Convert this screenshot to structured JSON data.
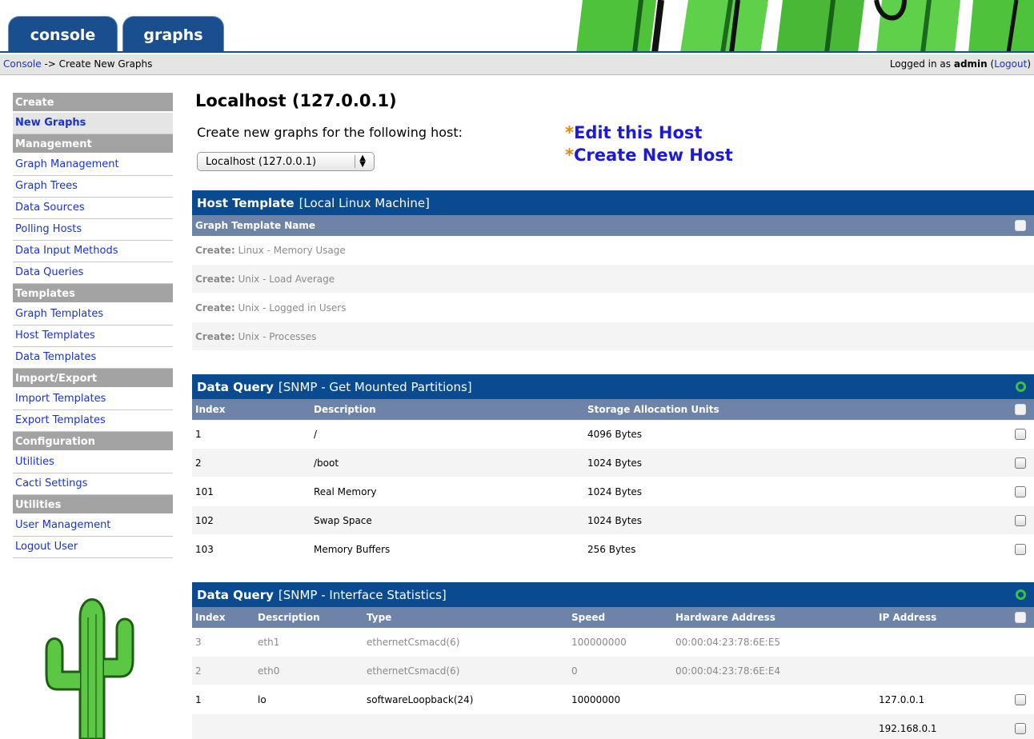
{
  "tabs": [
    {
      "label": "console"
    },
    {
      "label": "graphs"
    }
  ],
  "breadcrumb": {
    "link": "Console",
    "arrow": " -> ",
    "current": "Create New Graphs"
  },
  "login": {
    "prefix": "Logged in as ",
    "user": "admin",
    "open": " (",
    "logout": "Logout",
    "close": ")"
  },
  "sidebar": {
    "sections": [
      {
        "head": "Create",
        "items": [
          {
            "label": "New Graphs",
            "active": true
          }
        ]
      },
      {
        "head": "Management",
        "items": [
          {
            "label": "Graph Management"
          },
          {
            "label": "Graph Trees"
          },
          {
            "label": "Data Sources"
          },
          {
            "label": "Polling Hosts"
          },
          {
            "label": "Data Input Methods"
          },
          {
            "label": "Data Queries"
          }
        ]
      },
      {
        "head": "Templates",
        "items": [
          {
            "label": "Graph Templates"
          },
          {
            "label": "Host Templates"
          },
          {
            "label": "Data Templates"
          }
        ]
      },
      {
        "head": "Import/Export",
        "items": [
          {
            "label": "Import Templates"
          },
          {
            "label": "Export Templates"
          }
        ]
      },
      {
        "head": "Configuration",
        "items": [
          {
            "label": "Utilities"
          },
          {
            "label": "Cacti Settings"
          }
        ]
      },
      {
        "head": "Utilities",
        "items": [
          {
            "label": "User Management"
          },
          {
            "label": "Logout User"
          }
        ]
      }
    ]
  },
  "main": {
    "title": "Localhost (127.0.0.1)",
    "intro": "Create new graphs for the following host:",
    "host_select_value": "Localhost (127.0.0.1)",
    "link_star": "*",
    "edit_host": "Edit this Host",
    "create_host": "Create New Host"
  },
  "host_template": {
    "title": "Host Template",
    "subtitle": "[Local Linux Machine]",
    "column": "Graph Template Name",
    "create_label": "Create:",
    "rows": [
      " Linux - Memory Usage",
      " Unix - Load Average",
      " Unix - Logged in Users",
      " Unix - Processes"
    ]
  },
  "dq_partitions": {
    "title": "Data Query",
    "subtitle": "[SNMP - Get Mounted Partitions]",
    "columns": [
      "Index",
      "Description",
      "Storage Allocation Units"
    ],
    "rows": [
      [
        "1",
        "/",
        "4096 Bytes"
      ],
      [
        "2",
        "/boot",
        "1024 Bytes"
      ],
      [
        "101",
        "Real Memory",
        "1024 Bytes"
      ],
      [
        "102",
        "Swap Space",
        "1024 Bytes"
      ],
      [
        "103",
        "Memory Buffers",
        "256 Bytes"
      ]
    ]
  },
  "dq_interfaces": {
    "title": "Data Query",
    "subtitle": "[SNMP - Interface Statistics]",
    "columns": [
      "Index",
      "Description",
      "Type",
      "Speed",
      "Hardware Address",
      "IP Address"
    ],
    "rows": [
      {
        "cells": [
          "3",
          "eth1",
          "ethernetCsmacd(6)",
          "100000000",
          "00:00:04:23:78:6E:E5",
          ""
        ],
        "disabled": true
      },
      {
        "cells": [
          "2",
          "eth0",
          "ethernetCsmacd(6)",
          "0",
          "00:00:04:23:78:6E:E4",
          ""
        ],
        "disabled": true
      },
      {
        "cells": [
          "1",
          "lo",
          "softwareLoopback(24)",
          "10000000",
          "",
          "127.0.0.1"
        ],
        "disabled": false
      },
      {
        "cells": [
          "",
          "",
          "",
          "",
          "",
          "192.168.0.1"
        ],
        "disabled": false
      }
    ]
  },
  "colors": {
    "panel_header": "#0a4a91",
    "column_header": "#6d84a8",
    "sidebar_header": "#a3a3a3",
    "link": "#1a33cc",
    "status_ring": "#39c539"
  }
}
